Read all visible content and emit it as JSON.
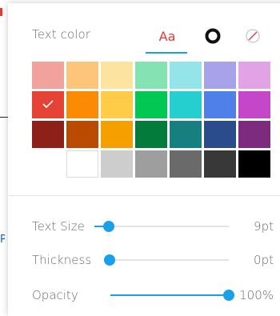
{
  "header": {
    "title": "Text color",
    "tab_text_label": "Aa",
    "tab_border_icon": "ring-icon",
    "tab_none_icon": "no-color-icon",
    "active_tab": "text"
  },
  "swatches": {
    "selected_index": 7,
    "rows": [
      [
        "#f2a29c",
        "#fcc579",
        "#fde3a0",
        "#84e3b3",
        "#94e5ea",
        "#a8a2ea",
        "#e2a2e6"
      ],
      [
        "#e44336",
        "#fb8b03",
        "#fecc47",
        "#00c853",
        "#26cfcf",
        "#4f7fe8",
        "#c447c9"
      ],
      [
        "#8d2019",
        "#b94a00",
        "#f59f00",
        "#027b3b",
        "#167f7f",
        "#2a4b8c",
        "#7c2b7f"
      ],
      [
        "",
        "#ffffff",
        "#cdcdcd",
        "#9e9e9e",
        "#6a6a6a",
        "#383838",
        "#000000"
      ]
    ]
  },
  "sliders": {
    "text_size": {
      "label": "Text Size",
      "value_text": "9pt",
      "fraction": 0.11
    },
    "thickness": {
      "label": "Thickness",
      "value_text": "0pt",
      "fraction": 0.0
    },
    "opacity": {
      "label": "Opacity",
      "value_text": "100%",
      "fraction": 1.0
    }
  },
  "colors": {
    "accent": "#1aa0e8",
    "active_tab_text": "#e53935",
    "label": "#6b6b6b"
  },
  "background": {
    "fragment_text": "Pi"
  }
}
